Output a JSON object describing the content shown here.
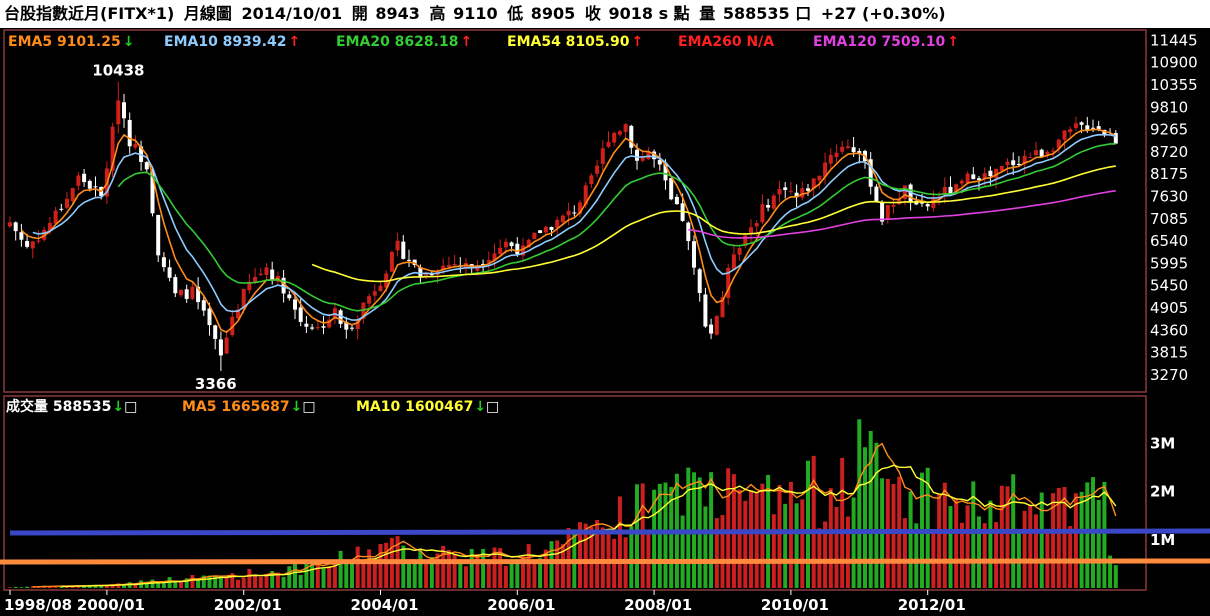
{
  "header": {
    "instrument": "台股指數近月(FITX*1)",
    "period": "月線圖",
    "date": "2014/10/01",
    "open_label": "開",
    "open": "8943",
    "high_label": "高",
    "high": "9110",
    "low_label": "低",
    "low": "8905",
    "close_label": "收",
    "close": "9018 s 點",
    "volume_label": "量",
    "volume": "588535 口",
    "change": "+27 (+0.30%)"
  },
  "colors": {
    "ema5": "#ff8c1a",
    "ema10": "#8ecbff",
    "ema20": "#33cc33",
    "ema54": "#ffff33",
    "ema260": "#ff2020",
    "ema120": "#e040e0",
    "up": "#d0201a",
    "down": "#ffffff",
    "vol_up": "#cc2020",
    "vol_down": "#22aa22",
    "ma5": "#ff8c1a",
    "ma10": "#ffff33",
    "frame": "#8b3a3a"
  },
  "price_legend": [
    {
      "label": "EMA5",
      "value": "9101.25",
      "arrow": "down",
      "color_key": "ema5"
    },
    {
      "label": "EMA10",
      "value": "8939.42",
      "arrow": "up",
      "color_key": "ema10"
    },
    {
      "label": "EMA20",
      "value": "8628.18",
      "arrow": "up",
      "color_key": "ema20"
    },
    {
      "label": "EMA54",
      "value": "8105.90",
      "arrow": "up",
      "color_key": "ema54"
    },
    {
      "label": "EMA260",
      "value": "N/A",
      "arrow": "none",
      "color_key": "ema260"
    },
    {
      "label": "EMA120",
      "value": "7509.10",
      "arrow": "up",
      "color_key": "ema120"
    }
  ],
  "volume_legend": [
    {
      "label": "成交量",
      "value": "588535",
      "arrow": "down",
      "color": "#ffffff"
    },
    {
      "label": "MA5",
      "value": "1665687",
      "arrow": "down",
      "color": "#ff8c1a"
    },
    {
      "label": "MA10",
      "value": "1600467",
      "arrow": "down",
      "color": "#ffff33"
    }
  ],
  "chart_data": {
    "type": "candlestick",
    "x_ticks": [
      "1998/08",
      "2000/01",
      "2002/01",
      "2004/01",
      "2006/01",
      "2008/01",
      "2010/01",
      "2012/01"
    ],
    "x_tick_index": [
      0,
      17,
      41,
      65,
      89,
      113,
      137,
      161
    ],
    "price_axis_ticks": [
      11445,
      10900,
      10355,
      9810,
      9265,
      8720,
      8175,
      7630,
      7085,
      6540,
      5995,
      5450,
      4905,
      4360,
      3815,
      3270
    ],
    "price_ylim": [
      2900,
      11650
    ],
    "annotations": [
      {
        "text": "10438",
        "index": 19,
        "value": 10438
      },
      {
        "text": "3366",
        "index": 37,
        "value": 3366
      }
    ],
    "volume_axis_ticks": [
      {
        "label": "3M",
        "value": 3000000
      },
      {
        "label": "2M",
        "value": 2000000
      },
      {
        "label": "1M",
        "value": 1000000
      }
    ],
    "volume_ylim": [
      0,
      3900000
    ],
    "count": 195,
    "price_anchors": [
      [
        0,
        7000
      ],
      [
        3,
        6400
      ],
      [
        6,
        6800
      ],
      [
        8,
        7200
      ],
      [
        10,
        7600
      ],
      [
        12,
        8100
      ],
      [
        14,
        7900
      ],
      [
        16,
        7600
      ],
      [
        18,
        9200
      ],
      [
        19,
        10100
      ],
      [
        21,
        9000
      ],
      [
        24,
        8400
      ],
      [
        26,
        6300
      ],
      [
        29,
        5200
      ],
      [
        32,
        5300
      ],
      [
        35,
        4400
      ],
      [
        37,
        3700
      ],
      [
        39,
        4700
      ],
      [
        42,
        5500
      ],
      [
        45,
        5900
      ],
      [
        48,
        5400
      ],
      [
        51,
        4600
      ],
      [
        54,
        4400
      ],
      [
        57,
        4800
      ],
      [
        59,
        4300
      ],
      [
        62,
        5000
      ],
      [
        65,
        5600
      ],
      [
        68,
        6400
      ],
      [
        70,
        6100
      ],
      [
        72,
        5700
      ],
      [
        75,
        5900
      ],
      [
        78,
        6000
      ],
      [
        81,
        5900
      ],
      [
        84,
        6200
      ],
      [
        87,
        6500
      ],
      [
        90,
        6300
      ],
      [
        93,
        6800
      ],
      [
        96,
        7000
      ],
      [
        99,
        7300
      ],
      [
        102,
        8000
      ],
      [
        105,
        9100
      ],
      [
        108,
        9400
      ],
      [
        110,
        8500
      ],
      [
        112,
        8700
      ],
      [
        114,
        8300
      ],
      [
        116,
        7500
      ],
      [
        118,
        7100
      ],
      [
        120,
        5800
      ],
      [
        122,
        4600
      ],
      [
        123,
        4300
      ],
      [
        125,
        5200
      ],
      [
        127,
        6300
      ],
      [
        130,
        6900
      ],
      [
        133,
        7500
      ],
      [
        136,
        7900
      ],
      [
        138,
        7600
      ],
      [
        141,
        8000
      ],
      [
        144,
        8700
      ],
      [
        147,
        8900
      ],
      [
        149,
        8700
      ],
      [
        151,
        8000
      ],
      [
        153,
        7100
      ],
      [
        155,
        7500
      ],
      [
        157,
        7800
      ],
      [
        159,
        7300
      ],
      [
        161,
        7400
      ],
      [
        163,
        7700
      ],
      [
        166,
        7800
      ],
      [
        169,
        8200
      ],
      [
        172,
        8100
      ],
      [
        175,
        8400
      ],
      [
        178,
        8600
      ],
      [
        181,
        8700
      ],
      [
        184,
        9000
      ],
      [
        187,
        9300
      ],
      [
        190,
        9400
      ],
      [
        192,
        9200
      ],
      [
        194,
        9018
      ]
    ],
    "volume_anchors": [
      [
        0,
        20000
      ],
      [
        15,
        60000
      ],
      [
        30,
        200000
      ],
      [
        45,
        350000
      ],
      [
        55,
        500000
      ],
      [
        65,
        900000
      ],
      [
        75,
        800000
      ],
      [
        85,
        700000
      ],
      [
        95,
        900000
      ],
      [
        100,
        1100000
      ],
      [
        105,
        1300000
      ],
      [
        110,
        1700000
      ],
      [
        115,
        2000000
      ],
      [
        120,
        2200000
      ],
      [
        125,
        2100000
      ],
      [
        130,
        1900000
      ],
      [
        135,
        2000000
      ],
      [
        140,
        2100000
      ],
      [
        145,
        2300000
      ],
      [
        149,
        2900000
      ],
      [
        152,
        2500000
      ],
      [
        155,
        2300000
      ],
      [
        160,
        2100000
      ],
      [
        165,
        1900000
      ],
      [
        170,
        1800000
      ],
      [
        175,
        1900000
      ],
      [
        180,
        1700000
      ],
      [
        185,
        1700000
      ],
      [
        190,
        1800000
      ],
      [
        194,
        588535
      ]
    ],
    "volume_spikes": [
      [
        149,
        3500000
      ],
      [
        146,
        2700000
      ],
      [
        190,
        2300000
      ],
      [
        192,
        2200000
      ],
      [
        120,
        2400000
      ],
      [
        107,
        1900000
      ]
    ]
  }
}
